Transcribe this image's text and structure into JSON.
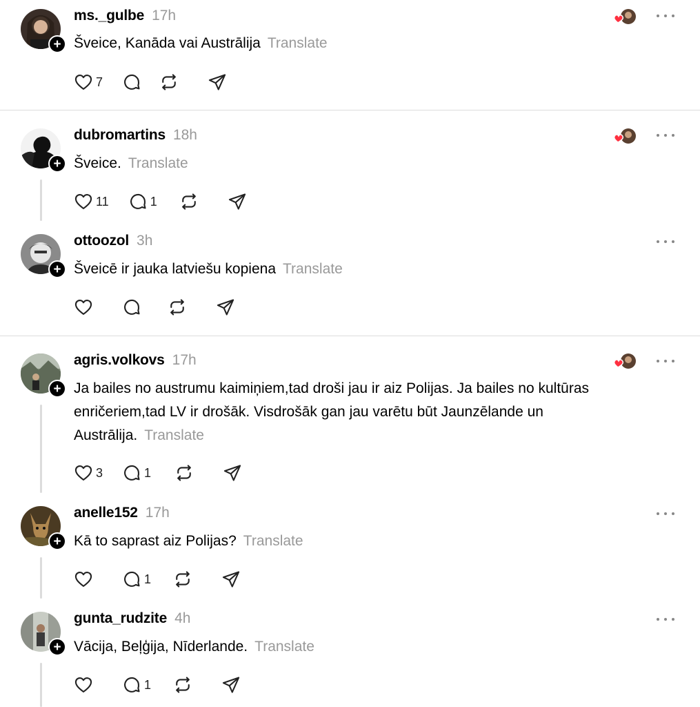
{
  "ui": {
    "translate_label": "Translate",
    "follow_symbol": "+"
  },
  "posts": [
    {
      "username": "ms._gulbe",
      "time": "17h",
      "text": "Šveice, Kanāda vai Austrālija",
      "likes": "7",
      "replies": "",
      "liked_by_author": true
    },
    {
      "username": "dubromartins",
      "time": "18h",
      "text": "Šveice.",
      "likes": "11",
      "replies": "1",
      "liked_by_author": true
    },
    {
      "username": "ottoozol",
      "time": "3h",
      "text": "Šveicē ir jauka latviešu kopiena",
      "likes": "",
      "replies": "",
      "liked_by_author": false
    },
    {
      "username": "agris.volkovs",
      "time": "17h",
      "text": "Ja bailes no austrumu kaimiņiem,tad droši jau ir aiz Polijas. Ja bailes no kultūras enričeriem,tad LV ir drošāk. Visdrošāk gan jau varētu būt Jaunzēlande un Austrālija.",
      "likes": "3",
      "replies": "1",
      "liked_by_author": true
    },
    {
      "username": "anelle152",
      "time": "17h",
      "text": "Kā to saprast aiz Polijas?",
      "likes": "",
      "replies": "1",
      "liked_by_author": false
    },
    {
      "username": "gunta_rudzite",
      "time": "4h",
      "text": "Vācija, Beļģija, Nīderlande.",
      "likes": "",
      "replies": "1",
      "liked_by_author": false
    }
  ],
  "colors": {
    "heart": "#ff3040",
    "muted": "#999999",
    "divider": "#dcdcdc"
  }
}
